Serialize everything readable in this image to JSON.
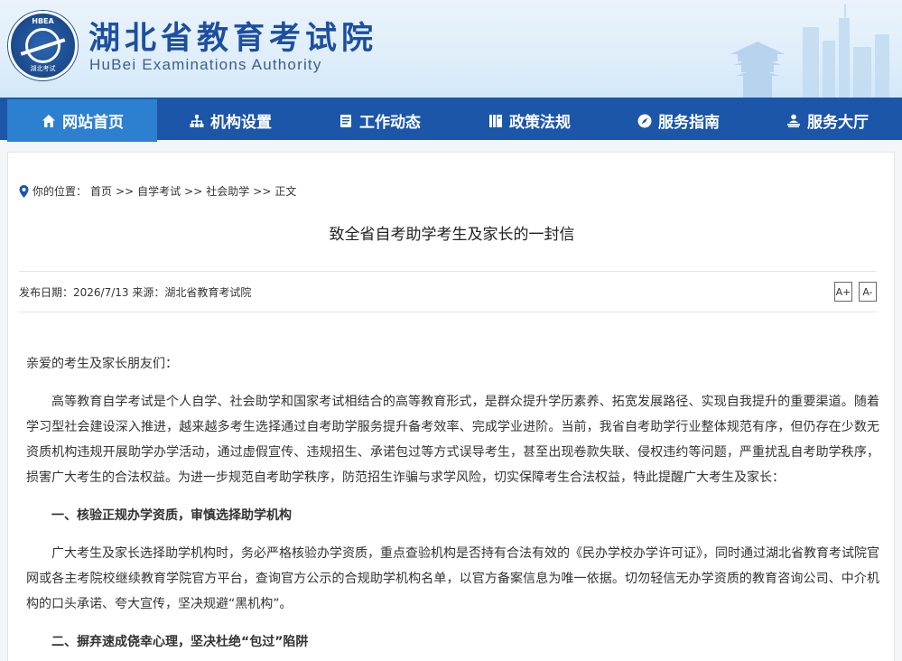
{
  "header": {
    "title": "湖北省教育考试院",
    "subtitle": "HuBei Examinations Authority",
    "logo_top": "HBEA",
    "logo_bottom": "湖北考试"
  },
  "nav": {
    "items": [
      {
        "label": "网站首页",
        "icon": "home-icon",
        "active": true
      },
      {
        "label": "机构设置",
        "icon": "org-chart-icon",
        "active": false
      },
      {
        "label": "工作动态",
        "icon": "document-icon",
        "active": false
      },
      {
        "label": "政策法规",
        "icon": "book-icon",
        "active": false
      },
      {
        "label": "服务指南",
        "icon": "compass-icon",
        "active": false
      },
      {
        "label": "服务大厅",
        "icon": "service-desk-icon",
        "active": false
      }
    ]
  },
  "breadcrumb": {
    "prefix": "你的位置：",
    "items": [
      "首页",
      "自学考试",
      "社会助学",
      "正文"
    ],
    "separator": ">>"
  },
  "article": {
    "title": "致全省自考助学考生及家长的一封信",
    "meta": "发布日期：2026/7/13 来源：湖北省教育考试院",
    "font_increase": "A+",
    "font_decrease": "A-",
    "salutation": "亲爱的考生及家长朋友们：",
    "paragraph_1": "高等教育自学考试是个人自学、社会助学和国家考试相结合的高等教育形式，是群众提升学历素养、拓宽发展路径、实现自我提升的重要渠道。随着学习型社会建设深入推进，越来越多考生选择通过自考助学服务提升备考效率、完成学业进阶。当前，我省自考助学行业整体规范有序，但仍存在少数无资质机构违规开展助学办学活动，通过虚假宣传、违规招生、承诺包过等方式误导考生，甚至出现卷款失联、侵权违约等问题，严重扰乱自考助学秩序，损害广大考生的合法权益。为进一步规范自考助学秩序，防范招生诈骗与求学风险，切实保障考生合法权益，特此提醒广大考生及家长：",
    "heading_1": "一、核验正规办学资质，审慎选择助学机构",
    "paragraph_2": "广大考生及家长选择助学机构时，务必严格核验办学资质，重点查验机构是否持有合法有效的《民办学校办学许可证》，同时通过湖北省教育考试院官网或各主考院校继续教育学院官方平台，查询官方公示的合规助学机构名单，以官方备案信息为唯一依据。切勿轻信无办学资质的教育咨询公司、中介机构的口头承诺、夸大宣传，坚决规避“黑机构”。",
    "heading_2": "二、摒弃速成侥幸心理，坚决杜绝“包过”陷阱"
  },
  "colors": {
    "nav_bg": "#1b56a8",
    "nav_active": "#2c80cf",
    "brand_text": "#1d4fa0"
  }
}
